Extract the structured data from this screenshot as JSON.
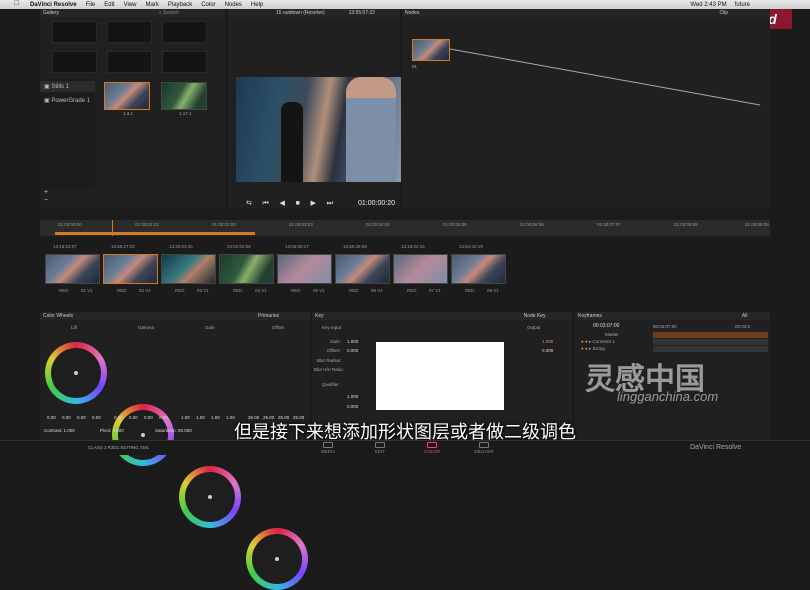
{
  "menubar": {
    "apple": "",
    "app": "DaVinci Resolve",
    "items": [
      "File",
      "Edit",
      "View",
      "Mark",
      "Playback",
      "Color",
      "Nodes",
      "Help"
    ],
    "status": {
      "day": "Wed 2:43 PM",
      "user": "future"
    }
  },
  "logo": {
    "text": "phd"
  },
  "gallery": {
    "title": "Gallery",
    "search": "Search",
    "albums": [
      "Stills 1",
      "PowerGrade 1"
    ],
    "stills": [
      {
        "label": "1.3.1"
      },
      {
        "label": "1.17.1"
      }
    ]
  },
  "viewer": {
    "title": "15 outdown (Resolve)",
    "timecode_top": "13:55:07:22",
    "timecode": "01:00:00:20"
  },
  "nodes": {
    "title": "Nodes",
    "clip_label": "Clip",
    "node_label": "01"
  },
  "timeline": {
    "ruler": [
      "01:00:00:00",
      "01:00:01:01",
      "01:00:02:02",
      "01:00:03:03",
      "01:00:04:04",
      "01:00:05:05",
      "01:00:06:06",
      "01:00:07:07",
      "01:00:08:08",
      "01:00:09:09"
    ],
    "clips": [
      {
        "tc": "13:19:23:07",
        "num": "01",
        "track": "V1"
      },
      {
        "tc": "13:55:27:22",
        "num": "02",
        "track": "V1"
      },
      {
        "tc": "13:20:03:16",
        "num": "03",
        "track": "V1"
      },
      {
        "tc": "23:52:04:08",
        "num": "04",
        "track": "V1"
      },
      {
        "tc": "13:08:09:17",
        "num": "05",
        "track": "V1"
      },
      {
        "tc": "13:55:28:08",
        "num": "06",
        "track": "V1"
      },
      {
        "tc": "13:19:22:16",
        "num": "07",
        "track": "V1"
      },
      {
        "tc": "13:54:43:19",
        "num": "08",
        "track": "V1"
      }
    ],
    "red_label": "RED"
  },
  "colorwheels": {
    "title": "Color Wheels",
    "mode": "Primaries",
    "wheels": [
      {
        "name": "Lift"
      },
      {
        "name": "Gamma"
      },
      {
        "name": "Gain"
      },
      {
        "name": "Offset"
      }
    ],
    "values_lift": [
      "0.00",
      "0.00",
      "0.00",
      "0.00"
    ],
    "values_gamma": [
      "0.00",
      "0.00",
      "0.00",
      "0.00"
    ],
    "values_gain": [
      "1.00",
      "1.00",
      "1.00",
      "1.00"
    ],
    "values_offset": [
      "25.00",
      "25.00",
      "25.00",
      "25.00"
    ],
    "contrast": "Contrast: 1.000",
    "pivot": "Pivot: 0.500",
    "saturation": "Saturation: 50.000"
  },
  "key": {
    "title": "Key",
    "node_key": "Node Key",
    "key_input": "Key Input",
    "output": "Output",
    "gain_label": "Gain:",
    "gain_value": "1.000",
    "offset_label": "Offset:",
    "offset_value": "0.000",
    "blur_radius": "Blur Radius:",
    "blur_hv": "Blur H/V Ratio:",
    "qualifier": "Qualifier",
    "gain2": "1.000",
    "offset2": "0.000",
    "out_gain": "1.000",
    "out_offset": "0.000"
  },
  "keyframes": {
    "title": "Keyframes",
    "all": "All",
    "timecode": "00:03:07:00",
    "ruler_start": "00:03:07:00",
    "ruler_end": "00:03:0",
    "tracks": [
      "Master",
      "Corrector 1",
      "Sizing"
    ]
  },
  "bottom": {
    "project": "CLASS 2 R3D1 EDITING XML",
    "brand": "DaVinci Resolve",
    "tabs": [
      "MEDIA",
      "EDIT",
      "COLOR",
      "DELIVER"
    ]
  },
  "subtitle": "但是接下来想添加形状图层或者做二级调色",
  "watermark": {
    "cn": "灵感中国",
    "url": "lingganchina.com"
  },
  "colors": {
    "accent": "#d87a1f",
    "active_tab": "#e84a5f"
  }
}
